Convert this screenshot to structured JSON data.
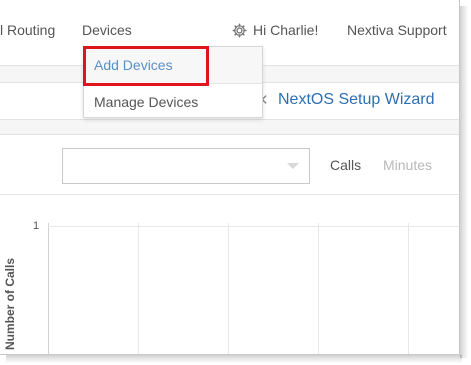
{
  "nav": {
    "routing_label": "l Routing",
    "devices_label": "Devices",
    "user_greeting": "Hi Charlie!",
    "support_label": "Nextiva Support"
  },
  "devices_menu": {
    "items": [
      {
        "label": "Add Devices",
        "highlighted": true
      },
      {
        "label": "Manage Devices",
        "highlighted": false
      }
    ],
    "highlight_color": "#e0141b"
  },
  "wizard": {
    "close_glyph": "✕",
    "link_label": "NextOS Setup Wizard"
  },
  "chart_panel": {
    "select_value": "",
    "toggle": {
      "calls_label": "Calls",
      "minutes_label": "Minutes",
      "active": "Calls"
    }
  },
  "chart_data": {
    "type": "bar",
    "categories": [],
    "series": [],
    "ylabel": "Number of Calls",
    "y_ticks": [
      "1"
    ],
    "ylim": [
      0,
      1
    ],
    "grid": true
  },
  "colors": {
    "link_blue": "#2f6fb0",
    "menu_active_blue": "#5b8fc7",
    "text_gray": "#555555",
    "muted_gray": "#b9b9b9"
  },
  "icons": {
    "user": "gear-icon",
    "select": "chevron-down-icon",
    "wizard_close": "close-icon"
  }
}
